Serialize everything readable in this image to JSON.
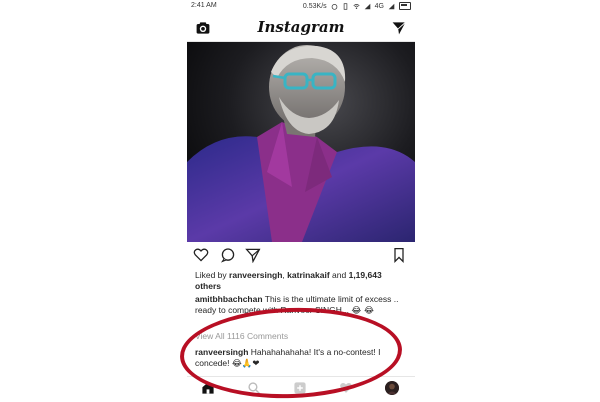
{
  "status_bar": {
    "time": "2:41 AM",
    "network_speed": "0.53K/s",
    "network_type": "4G"
  },
  "header": {
    "logo_text": "Instagram",
    "camera_icon": "camera-icon",
    "direct_icon": "paper-plane-icon"
  },
  "post": {
    "image_alt": "Amitabh Bachchan photo",
    "actions": [
      "heart-icon",
      "comment-icon",
      "share-icon",
      "bookmark-icon"
    ],
    "likes": {
      "prefix": "Liked by ",
      "user1": "ranveersingh",
      "sep1": ", ",
      "user2": "katrinakaif",
      "sep2": " and ",
      "count": "1,19,643",
      "suffix": "others"
    },
    "caption": {
      "username": "amitbhbachchan",
      "text": " This is the ultimate limit of excess .. ready to compete with Ranveer SINGH ..",
      "emoji": "😂 😂"
    },
    "view_comments": "View All 1116 Comments",
    "comment": {
      "username": "ranveersingh",
      "text": " Hahahahahaha! It's a no-contest! I concede!",
      "emoji": "😂🙏❤"
    }
  },
  "colors": {
    "annotation_red": "#b80f24",
    "heart_pink": "#e0306b",
    "muted_text": "#999999"
  }
}
